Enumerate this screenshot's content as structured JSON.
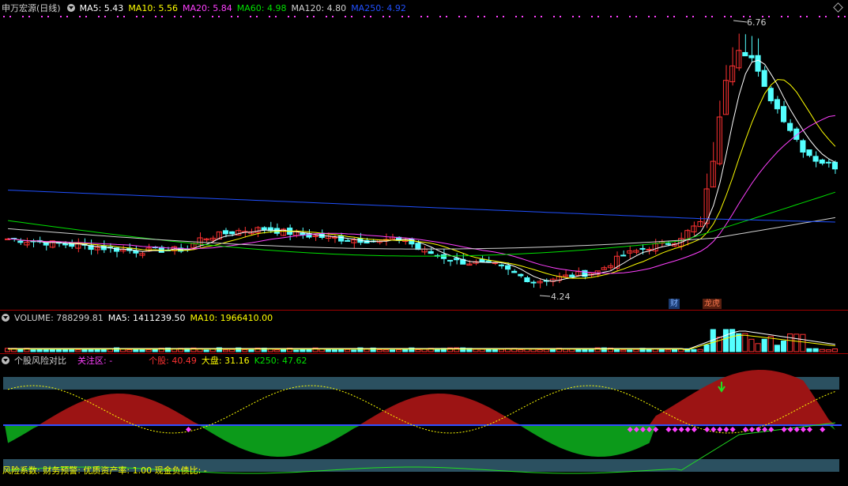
{
  "main_panel": {
    "stock_name": "申万宏源(日线)",
    "ma_labels": [
      {
        "text": "MA5: 5.43",
        "color": "#ffffff"
      },
      {
        "text": "MA10: 5.56",
        "color": "#ffff00"
      },
      {
        "text": "MA20: 5.84",
        "color": "#ff40ff"
      },
      {
        "text": "MA60: 4.98",
        "color": "#00e000"
      },
      {
        "text": "MA120: 4.80",
        "color": "#d0d0d0"
      },
      {
        "text": "MA250: 4.92",
        "color": "#2050ff"
      }
    ],
    "high_label": "6.76",
    "low_label": "4.24",
    "tag_finance": "财",
    "tag_rank": "龙虎"
  },
  "volume_panel": {
    "labels": [
      {
        "text": "VOLUME: 788299.81",
        "color": "#d0d0d0"
      },
      {
        "text": "MA5: 1411239.50",
        "color": "#ffffff"
      },
      {
        "text": "MA10: 1966410.00",
        "color": "#ffff00"
      }
    ]
  },
  "risk_panel": {
    "title": "个股风险对比",
    "focus_label": "关注区: -",
    "stock_label": "个股: 40.49",
    "market_label": "大盘: 31.16",
    "k250_label": "K250: 47.62",
    "footer": "风险系数: 财务预警: 优质资产率: 1.00 现金负债比: -"
  },
  "colors": {
    "up": "#ff3232",
    "down": "#54ffff",
    "ma5": "#ffffff",
    "ma10": "#ffff00",
    "ma20": "#ff40ff",
    "ma60": "#00e000",
    "ma120": "#d0d0d0",
    "ma250": "#2050ff",
    "risk_red": "#9c1414",
    "risk_green": "#0c9a1a",
    "band": "#2b5060",
    "divider": "#a00000"
  },
  "chart_data": {
    "type": "candlestick",
    "series_summary": {
      "high": 6.76,
      "low": 4.24,
      "last_ma": {
        "MA5": 5.43,
        "MA10": 5.56,
        "MA20": 5.84,
        "MA60": 4.98,
        "MA120": 4.8,
        "MA250": 4.92
      }
    },
    "volume": {
      "last": 788299.81,
      "ma5": 1411239.5,
      "ma10": 1966410.0
    },
    "risk": {
      "stock": 40.49,
      "market": 31.16,
      "k250": 47.62
    }
  }
}
